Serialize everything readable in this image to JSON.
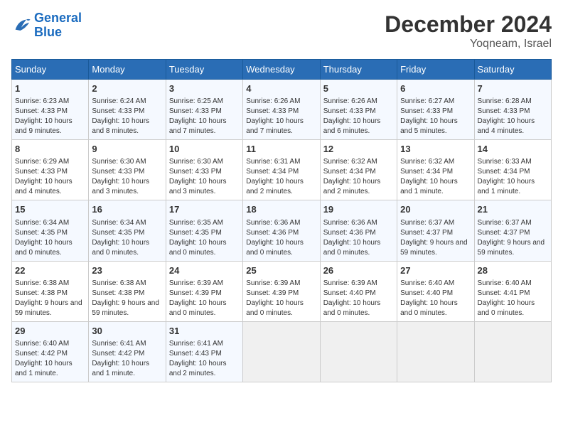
{
  "header": {
    "logo_line1": "General",
    "logo_line2": "Blue",
    "month": "December 2024",
    "location": "Yoqneam, Israel"
  },
  "weekdays": [
    "Sunday",
    "Monday",
    "Tuesday",
    "Wednesday",
    "Thursday",
    "Friday",
    "Saturday"
  ],
  "weeks": [
    [
      {
        "day": "1",
        "info": "Sunrise: 6:23 AM\nSunset: 4:33 PM\nDaylight: 10 hours and 9 minutes."
      },
      {
        "day": "2",
        "info": "Sunrise: 6:24 AM\nSunset: 4:33 PM\nDaylight: 10 hours and 8 minutes."
      },
      {
        "day": "3",
        "info": "Sunrise: 6:25 AM\nSunset: 4:33 PM\nDaylight: 10 hours and 7 minutes."
      },
      {
        "day": "4",
        "info": "Sunrise: 6:26 AM\nSunset: 4:33 PM\nDaylight: 10 hours and 7 minutes."
      },
      {
        "day": "5",
        "info": "Sunrise: 6:26 AM\nSunset: 4:33 PM\nDaylight: 10 hours and 6 minutes."
      },
      {
        "day": "6",
        "info": "Sunrise: 6:27 AM\nSunset: 4:33 PM\nDaylight: 10 hours and 5 minutes."
      },
      {
        "day": "7",
        "info": "Sunrise: 6:28 AM\nSunset: 4:33 PM\nDaylight: 10 hours and 4 minutes."
      }
    ],
    [
      {
        "day": "8",
        "info": "Sunrise: 6:29 AM\nSunset: 4:33 PM\nDaylight: 10 hours and 4 minutes."
      },
      {
        "day": "9",
        "info": "Sunrise: 6:30 AM\nSunset: 4:33 PM\nDaylight: 10 hours and 3 minutes."
      },
      {
        "day": "10",
        "info": "Sunrise: 6:30 AM\nSunset: 4:33 PM\nDaylight: 10 hours and 3 minutes."
      },
      {
        "day": "11",
        "info": "Sunrise: 6:31 AM\nSunset: 4:34 PM\nDaylight: 10 hours and 2 minutes."
      },
      {
        "day": "12",
        "info": "Sunrise: 6:32 AM\nSunset: 4:34 PM\nDaylight: 10 hours and 2 minutes."
      },
      {
        "day": "13",
        "info": "Sunrise: 6:32 AM\nSunset: 4:34 PM\nDaylight: 10 hours and 1 minute."
      },
      {
        "day": "14",
        "info": "Sunrise: 6:33 AM\nSunset: 4:34 PM\nDaylight: 10 hours and 1 minute."
      }
    ],
    [
      {
        "day": "15",
        "info": "Sunrise: 6:34 AM\nSunset: 4:35 PM\nDaylight: 10 hours and 0 minutes."
      },
      {
        "day": "16",
        "info": "Sunrise: 6:34 AM\nSunset: 4:35 PM\nDaylight: 10 hours and 0 minutes."
      },
      {
        "day": "17",
        "info": "Sunrise: 6:35 AM\nSunset: 4:35 PM\nDaylight: 10 hours and 0 minutes."
      },
      {
        "day": "18",
        "info": "Sunrise: 6:36 AM\nSunset: 4:36 PM\nDaylight: 10 hours and 0 minutes."
      },
      {
        "day": "19",
        "info": "Sunrise: 6:36 AM\nSunset: 4:36 PM\nDaylight: 10 hours and 0 minutes."
      },
      {
        "day": "20",
        "info": "Sunrise: 6:37 AM\nSunset: 4:37 PM\nDaylight: 9 hours and 59 minutes."
      },
      {
        "day": "21",
        "info": "Sunrise: 6:37 AM\nSunset: 4:37 PM\nDaylight: 9 hours and 59 minutes."
      }
    ],
    [
      {
        "day": "22",
        "info": "Sunrise: 6:38 AM\nSunset: 4:38 PM\nDaylight: 9 hours and 59 minutes."
      },
      {
        "day": "23",
        "info": "Sunrise: 6:38 AM\nSunset: 4:38 PM\nDaylight: 9 hours and 59 minutes."
      },
      {
        "day": "24",
        "info": "Sunrise: 6:39 AM\nSunset: 4:39 PM\nDaylight: 10 hours and 0 minutes."
      },
      {
        "day": "25",
        "info": "Sunrise: 6:39 AM\nSunset: 4:39 PM\nDaylight: 10 hours and 0 minutes."
      },
      {
        "day": "26",
        "info": "Sunrise: 6:39 AM\nSunset: 4:40 PM\nDaylight: 10 hours and 0 minutes."
      },
      {
        "day": "27",
        "info": "Sunrise: 6:40 AM\nSunset: 4:40 PM\nDaylight: 10 hours and 0 minutes."
      },
      {
        "day": "28",
        "info": "Sunrise: 6:40 AM\nSunset: 4:41 PM\nDaylight: 10 hours and 0 minutes."
      }
    ],
    [
      {
        "day": "29",
        "info": "Sunrise: 6:40 AM\nSunset: 4:42 PM\nDaylight: 10 hours and 1 minute."
      },
      {
        "day": "30",
        "info": "Sunrise: 6:41 AM\nSunset: 4:42 PM\nDaylight: 10 hours and 1 minute."
      },
      {
        "day": "31",
        "info": "Sunrise: 6:41 AM\nSunset: 4:43 PM\nDaylight: 10 hours and 2 minutes."
      },
      {
        "day": "",
        "info": ""
      },
      {
        "day": "",
        "info": ""
      },
      {
        "day": "",
        "info": ""
      },
      {
        "day": "",
        "info": ""
      }
    ]
  ]
}
